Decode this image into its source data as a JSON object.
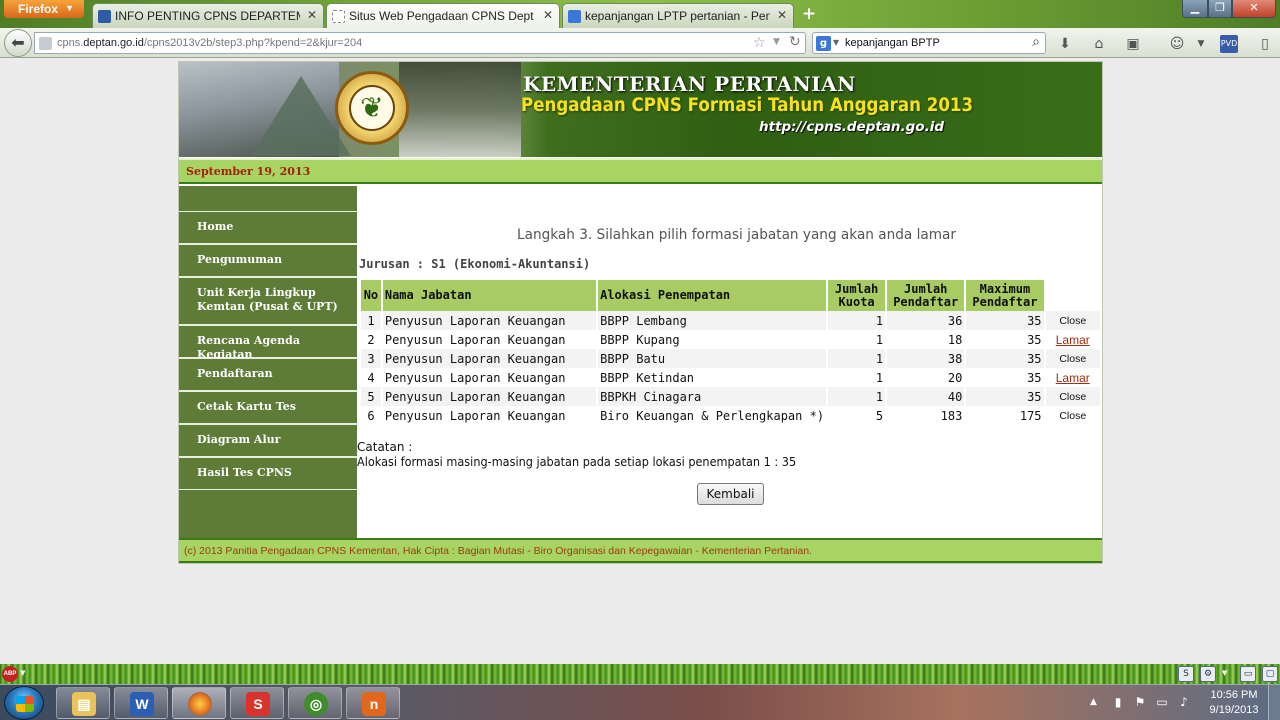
{
  "browser": {
    "app_button": "Firefox",
    "tabs": [
      {
        "title": "INFO PENTING CPNS DEPARTEMEN ...",
        "active": false
      },
      {
        "title": "Situs Web Pengadaan CPNS Deptan F...",
        "active": true
      },
      {
        "title": "kepanjangan LPTP pertanian - Penelu...",
        "active": false
      }
    ],
    "url_prefix": "cpns.",
    "url_domain": "deptan.go.id",
    "url_path": "/cpns2013v2b/step3.php?kpend=2&kjur=204",
    "search_text": "kepanjangan BPTP",
    "search_engine_letter": "g"
  },
  "site": {
    "banner_title": "KEMENTERIAN PERTANIAN",
    "banner_subtitle": "Pengadaan CPNS Formasi Tahun Anggaran 2013",
    "banner_url": "http://cpns.deptan.go.id",
    "date": "September 19, 2013",
    "menu": [
      {
        "label": "Home"
      },
      {
        "label": "Pengumuman"
      },
      {
        "label": "Unit Kerja Lingkup Kemtan (Pusat & UPT)"
      },
      {
        "label": "Rencana Agenda Kegiatan"
      },
      {
        "label": "Pendaftaran"
      },
      {
        "label": "Cetak Kartu Tes"
      },
      {
        "label": "Diagram Alur"
      },
      {
        "label": "Hasil Tes CPNS"
      }
    ],
    "step_title": "Langkah 3. Silahkan pilih formasi jabatan yang akan anda lamar",
    "jurusan": "Jurusan : S1 (Ekonomi-Akuntansi)",
    "table": {
      "headers": {
        "no": "No",
        "nama": "Nama Jabatan",
        "alokasi": "Alokasi Penempatan",
        "kuota": "Jumlah Kuota",
        "pendaftar": "Jumlah Pendaftar",
        "max": "Maximum Pendaftar"
      },
      "rows": [
        {
          "no": "1",
          "nama": "Penyusun Laporan Keuangan",
          "alokasi": "BBPP Lembang",
          "kuota": "1",
          "pendaftar": "36",
          "max": "35",
          "action": "Close"
        },
        {
          "no": "2",
          "nama": "Penyusun Laporan Keuangan",
          "alokasi": "BBPP Kupang",
          "kuota": "1",
          "pendaftar": "18",
          "max": "35",
          "action": "Lamar"
        },
        {
          "no": "3",
          "nama": "Penyusun Laporan Keuangan",
          "alokasi": "BBPP Batu",
          "kuota": "1",
          "pendaftar": "38",
          "max": "35",
          "action": "Close"
        },
        {
          "no": "4",
          "nama": "Penyusun Laporan Keuangan",
          "alokasi": "BBPP Ketindan",
          "kuota": "1",
          "pendaftar": "20",
          "max": "35",
          "action": "Lamar"
        },
        {
          "no": "5",
          "nama": "Penyusun Laporan Keuangan",
          "alokasi": "BBPKH Cinagara",
          "kuota": "1",
          "pendaftar": "40",
          "max": "35",
          "action": "Close"
        },
        {
          "no": "6",
          "nama": "Penyusun Laporan Keuangan",
          "alokasi": "Biro Keuangan & Perlengkapan *)",
          "kuota": "5",
          "pendaftar": "183",
          "max": "175",
          "action": "Close"
        }
      ]
    },
    "catatan_label": "Catatan :",
    "catatan_text": "Alokasi formasi masing-masing jabatan pada setiap lokasi penempatan 1 : 35",
    "kembali_label": "Kembali",
    "footer": "(c) 2013 Panitia Pengadaan CPNS Kementan, Hak Cipta : Bagian Mutasi - Biro Organisasi dan Kepegawaian - Kementerian Pertanian."
  },
  "taskbar": {
    "time": "10:56 PM",
    "date": "9/19/2013",
    "apps": [
      {
        "name": "explorer",
        "letter": "",
        "color": "#e9c25a"
      },
      {
        "name": "word",
        "letter": "W",
        "color": "#2b5fb4"
      },
      {
        "name": "firefox",
        "letter": "",
        "color": "#e3731c"
      },
      {
        "name": "app-red",
        "letter": "S",
        "color": "#d9342b"
      },
      {
        "name": "app-green",
        "letter": "",
        "color": "#3f8d2a"
      },
      {
        "name": "app-orange",
        "letter": "n",
        "color": "#e1661e"
      }
    ]
  },
  "colors": {
    "site_green": "#5e7c37",
    "header_green": "#a8cc63",
    "link_red": "#a33011",
    "date_red": "#a41f0c"
  }
}
